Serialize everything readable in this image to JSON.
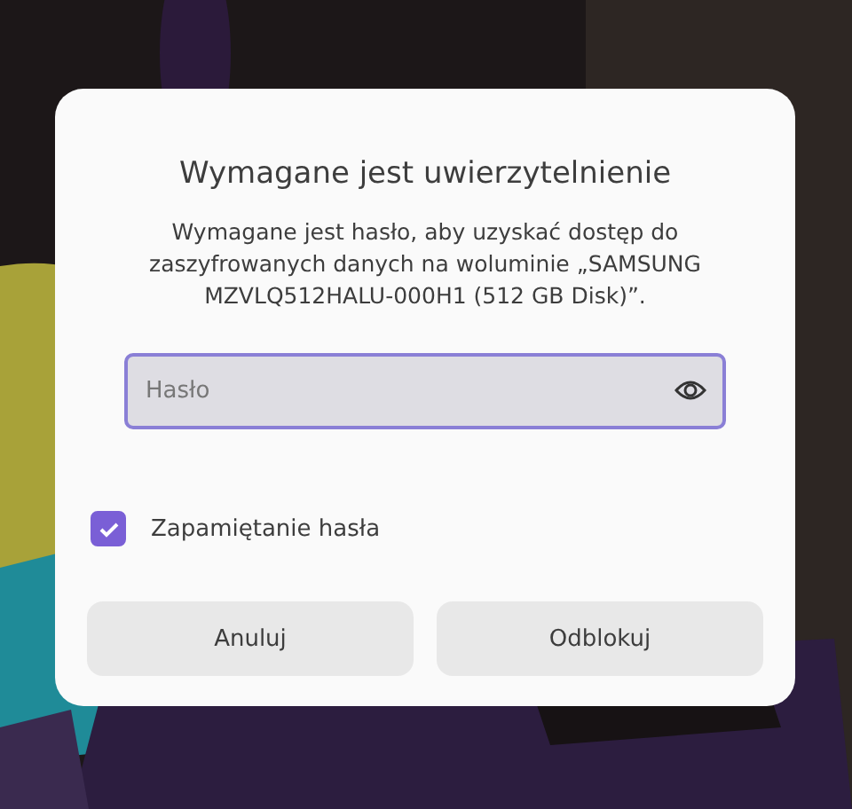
{
  "dialog": {
    "title": "Wymagane jest uwierzytelnienie",
    "message": "Wymagane jest hasło, aby uzyskać dostęp do zaszyfrowanych danych na woluminie „SAMSUNG MZVLQ512HALU-000H1 (512 GB Disk)”.",
    "password_field": {
      "placeholder": "Hasło"
    },
    "remember": {
      "label": "Zapamiętanie hasła",
      "checked": true
    },
    "buttons": [
      "Anuluj",
      "Odblokuj"
    ]
  }
}
